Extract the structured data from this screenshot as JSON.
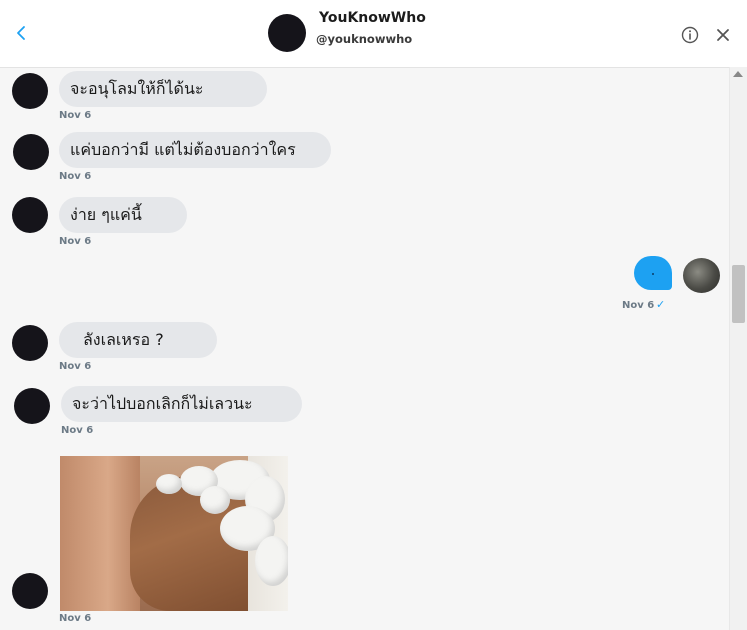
{
  "header": {
    "name": "YouKnowWho",
    "handle": "@youknowwho"
  },
  "icons": {
    "back": "chevron-left-icon",
    "info": "info-icon",
    "close": "close-icon"
  },
  "messages": [
    {
      "sender": "them",
      "text": "จะอนุโลมให้ก็ได้นะ",
      "time": "Nov 6"
    },
    {
      "sender": "them",
      "text": "แค่บอกว่ามี แต่ไม่ต้องบอกว่าใคร",
      "time": "Nov 6"
    },
    {
      "sender": "them",
      "text": "ง่าย ๆแค่นี้",
      "time": "Nov 6"
    },
    {
      "sender": "me",
      "text": "",
      "time": "Nov 6",
      "status": "✓"
    },
    {
      "sender": "them",
      "text": "ลังเลเหรอ ?",
      "time": "Nov 6"
    },
    {
      "sender": "them",
      "text": "จะว่าไปบอกเลิกก็ไม่เลวนะ",
      "time": "Nov 6"
    },
    {
      "sender": "them",
      "type": "image",
      "time": "Nov 6"
    }
  ],
  "colors": {
    "accent": "#1da1f2",
    "bubble": "#e5e7ea",
    "timestamp": "#6c7a86"
  }
}
